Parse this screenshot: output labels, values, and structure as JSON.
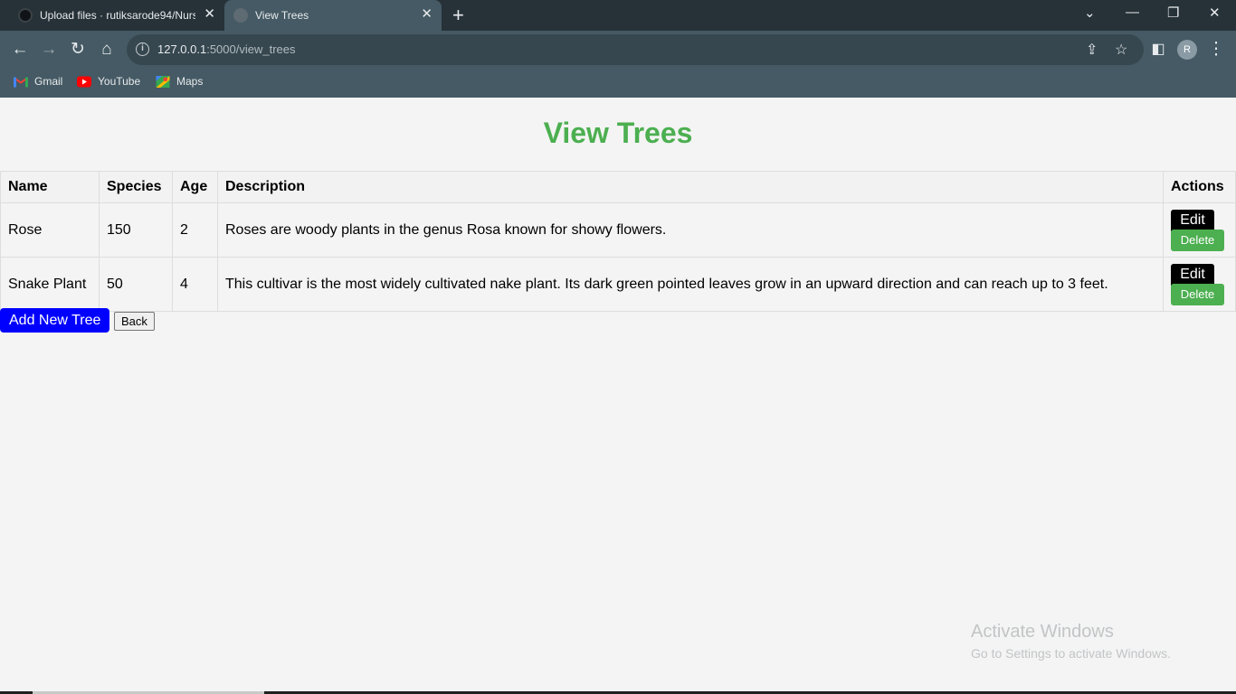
{
  "browser": {
    "tabs": [
      {
        "title": "Upload files · rutiksarode94/Nursery"
      },
      {
        "title": "View Trees"
      }
    ],
    "tab_close": "✕",
    "new_tab": "+",
    "window_controls": {
      "chevron": "⌄",
      "minimize": "—",
      "restore": "❐",
      "close": "✕"
    },
    "url_host": "127.0.0.1",
    "url_rest": ":5000/view_trees",
    "avatar_letter": "R",
    "bookmarks": [
      {
        "label": "Gmail",
        "icon": "gmail-icon"
      },
      {
        "label": "YouTube",
        "icon": "youtube-icon"
      },
      {
        "label": "Maps",
        "icon": "maps-icon"
      }
    ]
  },
  "page": {
    "title": "View Trees",
    "columns": {
      "name": "Name",
      "species": "Species",
      "age": "Age",
      "description": "Description",
      "actions": "Actions"
    },
    "rows": [
      {
        "name": "Rose",
        "species": "150",
        "age": "2",
        "description": "Roses are woody plants in the genus Rosa known for showy flowers."
      },
      {
        "name": "Snake Plant",
        "species": "50",
        "age": "4",
        "description": "This cultivar is the most widely cultivated nake plant. Its dark green pointed leaves grow in an upward direction and can reach up to 3 feet."
      }
    ],
    "edit_label": "Edit",
    "delete_label": "Delete",
    "add_label": "Add New Tree",
    "back_label": "Back"
  },
  "watermark": {
    "line1": "Activate Windows",
    "line2": "Go to Settings to activate Windows."
  },
  "colors": {
    "accent": "#4caf50",
    "add_button": "#0000ff",
    "chrome_dark": "#263238",
    "chrome": "#455a64"
  }
}
